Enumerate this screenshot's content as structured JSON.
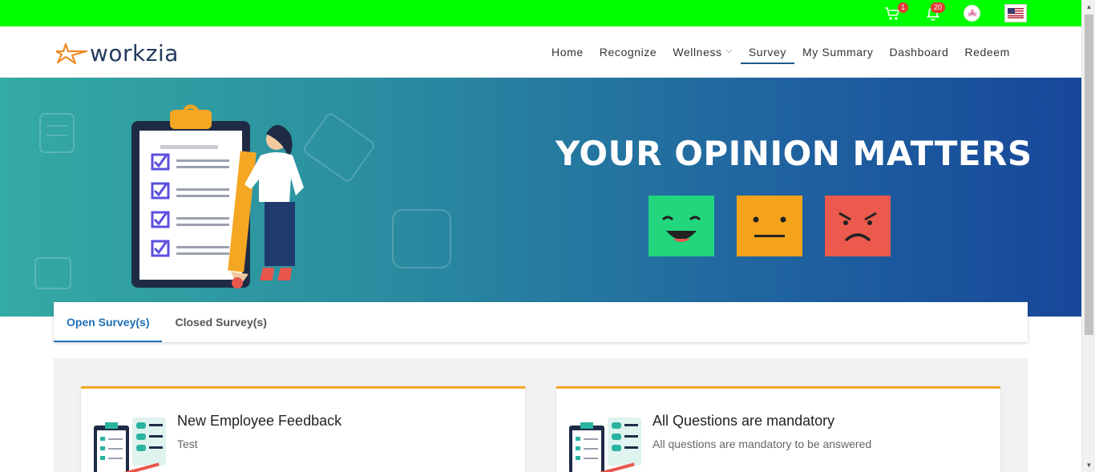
{
  "topbar": {
    "cart_badge": "1",
    "notifications_badge": "20"
  },
  "brand": {
    "logo_text": "workzia"
  },
  "nav": {
    "items": [
      {
        "label": "Home"
      },
      {
        "label": "Recognize"
      },
      {
        "label": "Wellness"
      },
      {
        "label": "Survey"
      },
      {
        "label": "My Summary"
      },
      {
        "label": "Dashboard"
      },
      {
        "label": "Redeem"
      }
    ],
    "active": "Survey"
  },
  "banner": {
    "title": "YOUR OPINION MATTERS"
  },
  "tabs": {
    "open": "Open Survey(s)",
    "closed": "Closed Survey(s)"
  },
  "surveys": [
    {
      "title": "New Employee Feedback",
      "description": "Test"
    },
    {
      "title": "All Questions are mandatory",
      "description": "All questions are mandatory to be answered"
    }
  ],
  "colors": {
    "topbar": "#00ff00",
    "accent": "#1f6fb5",
    "card_border": "#f5a623",
    "badge": "#e53935"
  }
}
